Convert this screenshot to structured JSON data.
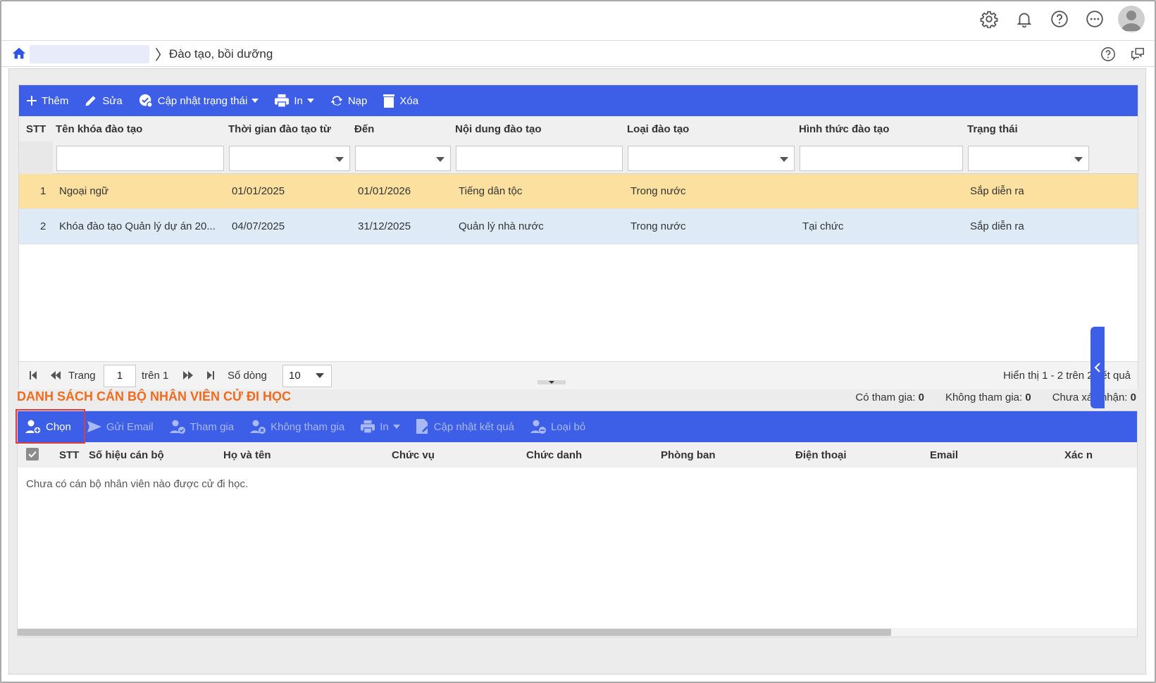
{
  "breadcrumb": {
    "current": "Đào tạo, bồi dưỡng"
  },
  "courses": {
    "toolbar": {
      "add": "Thêm",
      "edit": "Sửa",
      "update_status": "Cập nhật trạng thái",
      "print": "In",
      "reload": "Nạp",
      "delete": "Xóa"
    },
    "columns": {
      "stt": "STT",
      "name": "Tên khóa đào tạo",
      "from": "Thời gian đào tạo từ",
      "to": "Đến",
      "content": "Nội dung đào tạo",
      "type": "Loại đào tạo",
      "form": "Hình thức đào tạo",
      "status": "Trạng thái"
    },
    "rows": [
      {
        "stt": "1",
        "name": "Ngoại ngữ",
        "from": "01/01/2025",
        "to": "01/01/2026",
        "content": "Tiếng dân tộc",
        "type": "Trong nước",
        "form": "",
        "status": "Sắp diễn ra"
      },
      {
        "stt": "2",
        "name": "Khóa đào tạo Quản lý dự án 20...",
        "from": "04/07/2025",
        "to": "31/12/2025",
        "content": "Quản lý nhà nước",
        "type": "Trong nước",
        "form": "Tại chức",
        "status": "Sắp diễn ra"
      }
    ],
    "pager": {
      "page_label": "Trang",
      "page": "1",
      "of_label": "trên 1",
      "rows_label": "Số dòng",
      "rows_per_page": "10",
      "summary": "Hiển thị 1 - 2 trên 2 kết quả"
    }
  },
  "trainees": {
    "title": "DANH SÁCH CÁN BỘ NHÂN VIÊN CỬ ĐI HỌC",
    "counts": {
      "joined_label": "Có tham gia:",
      "joined": "0",
      "not_joined_label": "Không tham gia:",
      "not_joined": "0",
      "unconfirmed_label": "Chưa xác nhận:",
      "unconfirmed": "0"
    },
    "toolbar": {
      "choose": "Chọn",
      "send_email": "Gửi Email",
      "join": "Tham gia",
      "not_join": "Không tham gia",
      "print": "In",
      "update_result": "Cập nhật kết quả",
      "remove": "Loại bỏ"
    },
    "columns": {
      "stt": "STT",
      "code": "Số hiệu cán bộ",
      "name": "Họ và tên",
      "position": "Chức vụ",
      "title": "Chức danh",
      "department": "Phòng ban",
      "phone": "Điện thoại",
      "email": "Email",
      "confirm": "Xác n"
    },
    "empty": "Chưa có cán bộ nhân viên nào được cử đi học."
  },
  "colors": {
    "accent": "#3d5fe8",
    "selected_row": "#fbe0a0",
    "alt_row": "#deebf7",
    "section_title": "#f26b1d",
    "highlight_box": "#e03c3c"
  }
}
